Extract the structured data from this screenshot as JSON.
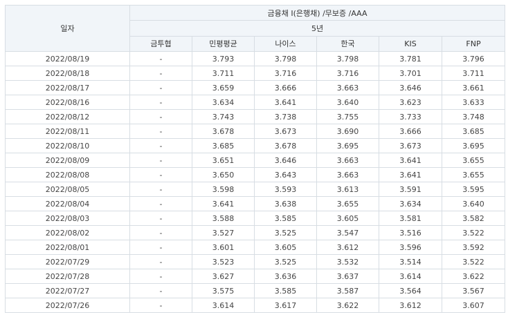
{
  "table": {
    "date_header": "일자",
    "group_header": "금융채 I(은행채) /무보증 /AAA",
    "term_header": "5년",
    "columns": [
      "금투협",
      "민평평균",
      "나이스",
      "한국",
      "KIS",
      "FNP"
    ],
    "rows": [
      [
        "2022/08/19",
        "-",
        "3.793",
        "3.798",
        "3.798",
        "3.781",
        "3.796"
      ],
      [
        "2022/08/18",
        "-",
        "3.711",
        "3.716",
        "3.716",
        "3.701",
        "3.711"
      ],
      [
        "2022/08/17",
        "-",
        "3.659",
        "3.666",
        "3.663",
        "3.646",
        "3.661"
      ],
      [
        "2022/08/16",
        "-",
        "3.634",
        "3.641",
        "3.640",
        "3.623",
        "3.633"
      ],
      [
        "2022/08/12",
        "-",
        "3.743",
        "3.738",
        "3.755",
        "3.733",
        "3.748"
      ],
      [
        "2022/08/11",
        "-",
        "3.678",
        "3.673",
        "3.690",
        "3.666",
        "3.685"
      ],
      [
        "2022/08/10",
        "-",
        "3.685",
        "3.678",
        "3.695",
        "3.673",
        "3.695"
      ],
      [
        "2022/08/09",
        "-",
        "3.651",
        "3.646",
        "3.663",
        "3.641",
        "3.655"
      ],
      [
        "2022/08/08",
        "-",
        "3.650",
        "3.643",
        "3.663",
        "3.641",
        "3.655"
      ],
      [
        "2022/08/05",
        "-",
        "3.598",
        "3.593",
        "3.613",
        "3.591",
        "3.595"
      ],
      [
        "2022/08/04",
        "-",
        "3.641",
        "3.638",
        "3.655",
        "3.634",
        "3.640"
      ],
      [
        "2022/08/03",
        "-",
        "3.588",
        "3.585",
        "3.605",
        "3.581",
        "3.582"
      ],
      [
        "2022/08/02",
        "-",
        "3.527",
        "3.525",
        "3.547",
        "3.516",
        "3.522"
      ],
      [
        "2022/08/01",
        "-",
        "3.601",
        "3.605",
        "3.612",
        "3.596",
        "3.592"
      ],
      [
        "2022/07/29",
        "-",
        "3.523",
        "3.525",
        "3.532",
        "3.514",
        "3.522"
      ],
      [
        "2022/07/28",
        "-",
        "3.627",
        "3.636",
        "3.637",
        "3.614",
        "3.622"
      ],
      [
        "2022/07/27",
        "-",
        "3.575",
        "3.585",
        "3.587",
        "3.564",
        "3.567"
      ],
      [
        "2022/07/26",
        "-",
        "3.614",
        "3.617",
        "3.622",
        "3.612",
        "3.607"
      ]
    ]
  }
}
